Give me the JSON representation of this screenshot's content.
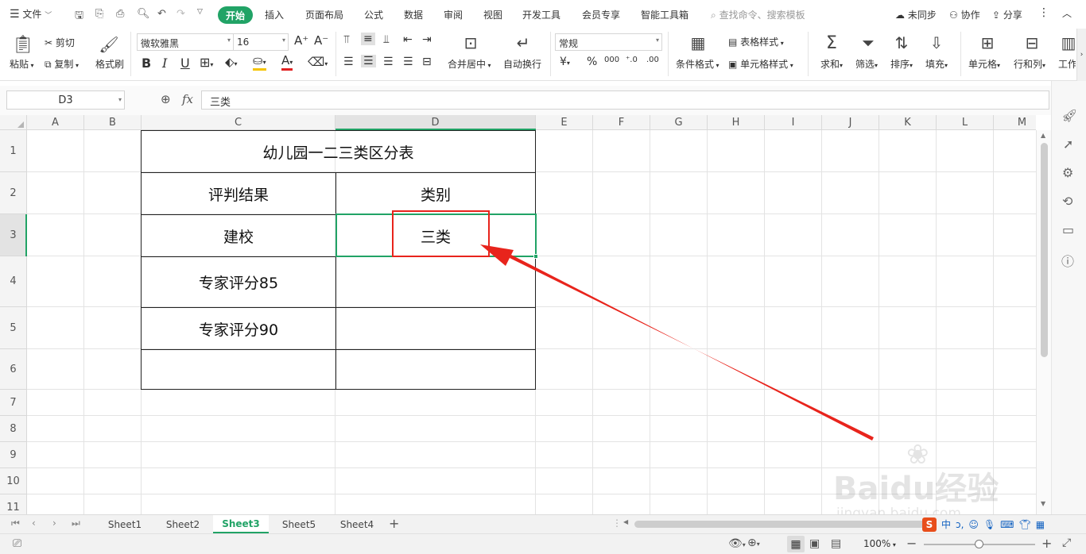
{
  "titlebar": {
    "menu_label": "文件",
    "tabs": [
      "开始",
      "插入",
      "页面布局",
      "公式",
      "数据",
      "审阅",
      "视图",
      "开发工具",
      "会员专享",
      "智能工具箱"
    ],
    "active_tab": "开始",
    "search_placeholder": "查找命令、搜索模板",
    "sync_label": "未同步",
    "collab_label": "协作",
    "share_label": "分享"
  },
  "ribbon": {
    "paste": "粘贴",
    "cut": "剪切",
    "copy": "复制",
    "format_painter": "格式刷",
    "font_name": "微软雅黑",
    "font_size": "16",
    "merge_center": "合并居中",
    "wrap_text": "自动换行",
    "number_format": "常规",
    "conditional_format": "条件格式",
    "table_style": "表格样式",
    "cell_style": "单元格样式",
    "sum": "求和",
    "filter": "筛选",
    "sort": "排序",
    "fill": "填充",
    "cell": "单元格",
    "row_col": "行和列",
    "worksheet": "工作"
  },
  "formula_bar": {
    "name_box": "D3",
    "fx": "fx",
    "content": "三类"
  },
  "grid": {
    "columns": [
      "A",
      "B",
      "C",
      "D",
      "E",
      "F",
      "G",
      "H",
      "I",
      "J",
      "K",
      "L",
      "M"
    ],
    "rows": [
      "1",
      "2",
      "3",
      "4",
      "5",
      "6",
      "7",
      "8",
      "9",
      "10",
      "11"
    ],
    "active_col": "D",
    "active_row": "3",
    "cells": {
      "title": "幼儿园一二三类区分表",
      "c2": "评判结果",
      "d2": "类别",
      "c3": "建校",
      "d3": "三类",
      "c4": "专家评分85",
      "c5": "专家评分90"
    }
  },
  "sheets": [
    "Sheet1",
    "Sheet2",
    "Sheet3",
    "Sheet5",
    "Sheet4"
  ],
  "active_sheet": "Sheet3",
  "status": {
    "zoom": "100%"
  },
  "watermark": {
    "brand": "Baidu经验",
    "url": "jingyan.baidu.com"
  },
  "colors": {
    "accent": "#21a366",
    "annotation": "#e8241c"
  }
}
